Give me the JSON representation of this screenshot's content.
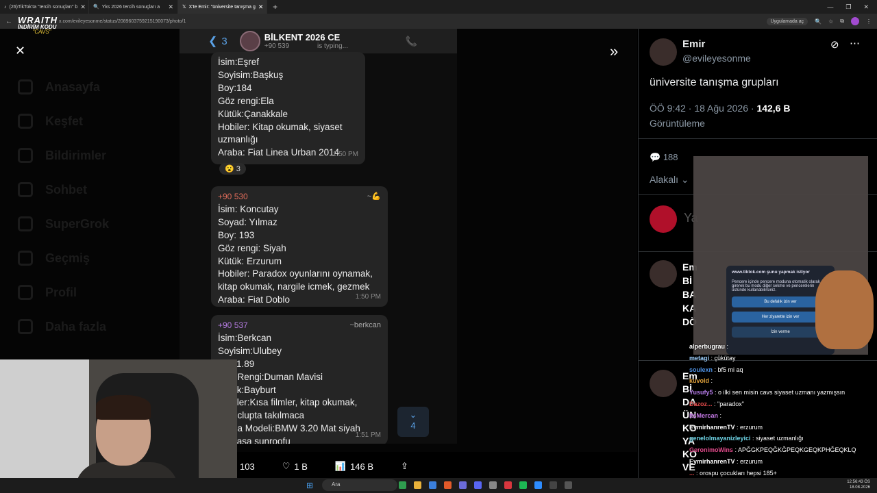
{
  "browser": {
    "tabs": [
      {
        "label": "(26)TikTok'ta \"tercih sonuçları\" b",
        "active": false
      },
      {
        "label": "Yks 2026 tercih sonuçları a",
        "active": false
      },
      {
        "label": "X'te Emir: \"üniversite tanışma g",
        "active": true
      }
    ],
    "url": "x.com/evileyesonme/status/2089603759215190073/photo/1",
    "app_chip": "Uygulamada aç"
  },
  "stream_logo": {
    "line1": "WRAITH",
    "line2": "İNDİRİM KODU",
    "line3": "\"CAVS\""
  },
  "sidebar": {
    "items": [
      "Anasayfa",
      "Keşfet",
      "Bildirimler",
      "Sohbet",
      "SuperGrok",
      "Geçmiş",
      "Profil",
      "Daha fazla"
    ]
  },
  "chat_screenshot": {
    "back_count": "3",
    "group_name": "BİLKENT 2026 CE",
    "status_number": "+90 539",
    "status_text": "is typing...",
    "messages": [
      {
        "sender": "",
        "signature": "",
        "lines": [
          "İsim:Eşref",
          "Soyisim:Başkuş",
          "Boy:184",
          "Göz rengi:Ela",
          "Kütük:Çanakkale",
          "Hobiler: Kitap okumak, siyaset",
          "uzmanlığı",
          "Araba: Fiat Linea Urban 2014"
        ],
        "time": "1:50 PM",
        "reaction": "😮 3"
      },
      {
        "sender": "+90 530",
        "signature": "~💪",
        "lines": [
          "İsim: Koncutay",
          "Soyad: Yılmaz",
          "Boy: 193",
          "Göz rengi: Siyah",
          "Kütük: Erzurum",
          "Hobiler: Paradox oyunlarını oynamak,",
          "kitap okumak, nargile icmek, gezmek",
          "Araba: Fiat Doblo"
        ],
        "time": "1:50 PM"
      },
      {
        "sender": "+90 537",
        "signature": "~berkcan",
        "lines": [
          "İsim:Berkcan",
          "Soyisim:Ulubey",
          "Boy:1.89",
          "Göz Rengi:Duman Mavisi",
          "Kütük:Bayburt",
          "Hobiler:Kısa filmler, kitap okumak,",
          "aile, clupta takılmaca",
          "Araba Modeli:BMW 3.20 Mat siyah",
          "full kasa sunroofu"
        ],
        "time": "1:51 PM"
      }
    ],
    "unread_count": "4"
  },
  "media_actions": {
    "replies": "103",
    "likes": "1 B",
    "views": "146 B"
  },
  "tweet": {
    "name": "Emir",
    "handle": "@evileyesonme",
    "text": "üniversite tanışma grupları",
    "time": "ÖÖ 9:42 · 18 Ağu 2026 · ",
    "views_count": "142,6 B",
    "views_label": "Görüntüleme",
    "reply_count": "188",
    "sort_label": "Alakalı",
    "reply_placeholder": "Ya",
    "reply_preview_1": [
      "Em",
      "Bİ",
      "BA",
      "KA",
      "DÖ"
    ],
    "reply_preview_2": [
      "Em",
      "Bİ",
      "DA",
      "ÜN",
      "KO",
      "YA",
      "KO",
      "VE"
    ]
  },
  "popup": {
    "title": "www.tiktok.com şunu yapmak istiyor",
    "body": "Pencere içinde pencere moduna otomatik olarak girerek bu modu diğer sekme ve pencerelerin üstünde kullanabilirsiniz.",
    "buttons": [
      "Bu defalık izin ver",
      "Her ziyarette izin ver",
      "İzin verme"
    ]
  },
  "live_chat": [
    {
      "user": "alperbugrau",
      "color": "#ffffff",
      "text": ""
    },
    {
      "user": "metagi",
      "color": "#9fd1ff",
      "text": "çükütay"
    },
    {
      "user": "soulexn",
      "color": "#4d8fe0",
      "text": "bf5 mi aq"
    },
    {
      "user": "kuvold",
      "color": "#e0a13c",
      "text": ""
    },
    {
      "user": "Yusufy5",
      "color": "#b57be8",
      "text": "o ilki sen misin cavs siyaset uzmanı yazmışsın"
    },
    {
      "user": "Dazoz...",
      "color": "#e34a4a",
      "text": "\"paradox\""
    },
    {
      "user": "ItsMercan",
      "color": "#c77be8",
      "text": ""
    },
    {
      "user": "EymirhanrenTV",
      "color": "#ffffff",
      "text": "erzurum"
    },
    {
      "user": "genelolmayanizleyici",
      "color": "#6fd6e8",
      "text": "siyaset uzmanlığı"
    },
    {
      "user": "GeronimoWins",
      "color": "#e04a8a",
      "text": "APĞGKPEQĞKĞPEQKGEQKPHĞEQKLQ"
    },
    {
      "user": "EymirhanrenTV",
      "color": "#ffffff",
      "text": "erzurum"
    },
    {
      "user": "...",
      "color": "#e34a4a",
      "text": "orospu çocukları hepsi 185+"
    }
  ],
  "taskbar": {
    "search_label": "Ara",
    "time": "12:56:43 ÖS",
    "date": "18.08.2026"
  }
}
